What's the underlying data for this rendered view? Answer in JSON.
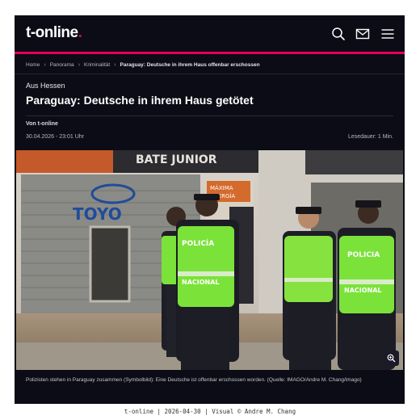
{
  "header": {
    "logo_text": "t-online",
    "logo_dot": ".",
    "icons": [
      "search-icon",
      "mail-icon",
      "menu-icon"
    ]
  },
  "breadcrumb": {
    "items": [
      "Home",
      "Panorama",
      "Kriminalität"
    ],
    "current": "Paraguay: Deutsche in ihrem Haus offenbar erschossen"
  },
  "article": {
    "kicker": "Aus Hessen",
    "headline": "Paraguay: Deutsche in ihrem Haus getötet",
    "byline": "Von t-online",
    "date": "30.04.2026 - 23:01 Uhr",
    "reading_time": "Lesedauer: 1 Min."
  },
  "image": {
    "storefront_sign": "BATE JUNIOR",
    "brand_sign": "TOYO",
    "banner_text": [
      "MÁXIMA",
      "ENERGÍA"
    ],
    "vest_labels": [
      "POLICÍA",
      "NACIONAL",
      "POLICIA",
      "NACIONAL"
    ],
    "zoom_icon": "zoom-icon",
    "caption": "Polizisten stehen in Paraguay zusammen (Symbolbild): Eine Deutsche ist offenbar erschossen worden. (Quelle: IMAGO/Andre M. Chang/imago)"
  },
  "footer": {
    "credit": "t-online | 2026-04-30 | Visual © Andre M. Chang"
  },
  "colors": {
    "accent": "#e5005b",
    "background": "#0c0c16",
    "vest": "#7be23a"
  }
}
